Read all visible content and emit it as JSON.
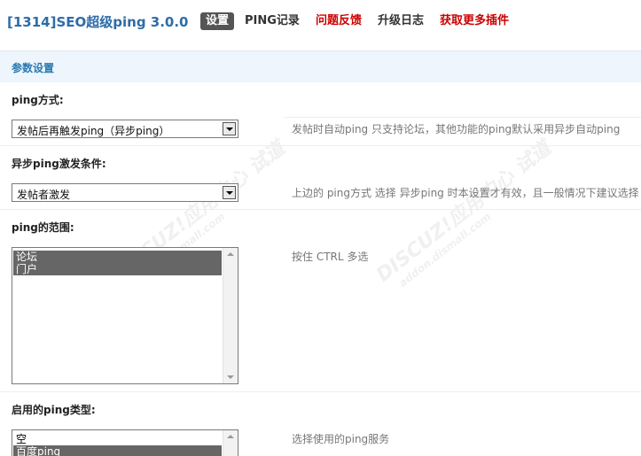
{
  "header": {
    "title": "[1314]SEO超级ping 3.0.0",
    "nav": [
      {
        "label": "设置",
        "active": true,
        "color": "#555555"
      },
      {
        "label": "PING记录",
        "active": false,
        "color": "#333333"
      },
      {
        "label": "问题反馈",
        "active": false,
        "color": "#cc0000"
      },
      {
        "label": "升级日志",
        "active": false,
        "color": "#333333"
      },
      {
        "label": "获取更多插件",
        "active": false,
        "color": "#cc0000"
      }
    ]
  },
  "section": {
    "title": "参数设置"
  },
  "settings": {
    "ping_mode": {
      "label": "ping方式:",
      "value": "发帖后再触发ping（异步ping）",
      "tip": "发帖时自动ping 只支持论坛，其他功能的ping默认采用异步自动ping"
    },
    "async_trigger": {
      "label": "异步ping激发条件:",
      "value": "发帖者激发",
      "tip": "上边的 ping方式 选择 异步ping 时本设置才有效，且一般情况下建议选择"
    },
    "ping_scope": {
      "label": "ping的范围:",
      "options": [
        "论坛",
        "门户"
      ],
      "tip": "按住 CTRL 多选"
    },
    "ping_types": {
      "label": "启用的ping类型:",
      "options": [
        "空",
        "百度ping"
      ],
      "tip": "选择使用的ping服务"
    }
  },
  "watermark": {
    "text": "DISCUZ!应用中心 试道",
    "sub": "addon.dismall.com"
  }
}
